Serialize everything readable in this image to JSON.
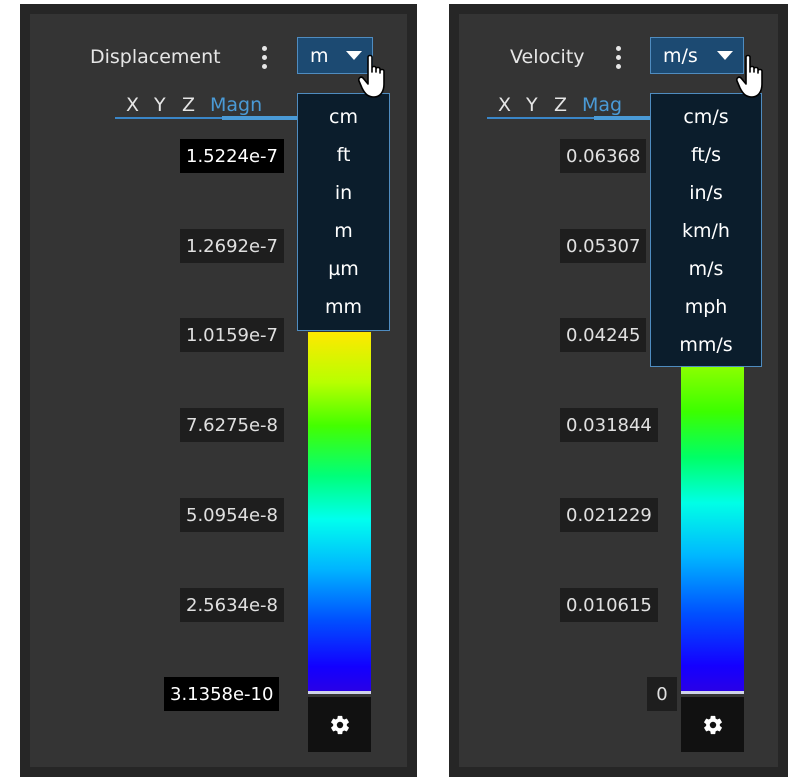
{
  "panels": [
    {
      "quantity": "Displacement",
      "unit": "m",
      "tabs": [
        "X",
        "Y",
        "Z",
        "Magn"
      ],
      "ticks": [
        "1.5224e-7",
        "1.2692e-7",
        "1.0159e-7",
        "7.6275e-8",
        "5.0954e-8",
        "2.5634e-8",
        "3.1358e-10"
      ],
      "unit_options": [
        "cm",
        "ft",
        "in",
        "m",
        "µm",
        "mm"
      ]
    },
    {
      "quantity": "Velocity",
      "unit": "m/s",
      "tabs": [
        "X",
        "Y",
        "Z",
        "Mag"
      ],
      "ticks": [
        "0.06368",
        "0.05307",
        "0.04245",
        "0.031844",
        "0.021229",
        "0.010615",
        "0"
      ],
      "unit_options": [
        "cm/s",
        "ft/s",
        "in/s",
        "km/h",
        "m/s",
        "mph",
        "mm/s"
      ]
    }
  ],
  "colors": {
    "accent": "#4a9ad6",
    "unit_button": "#1c4a72",
    "menu_bg": "#0b1d2c",
    "panel_bg": "#343434"
  },
  "icons": {
    "settings": "gear-icon",
    "more": "kebab-menu-icon",
    "dropdown": "caret-down-icon",
    "pointer": "hand-cursor-icon"
  }
}
